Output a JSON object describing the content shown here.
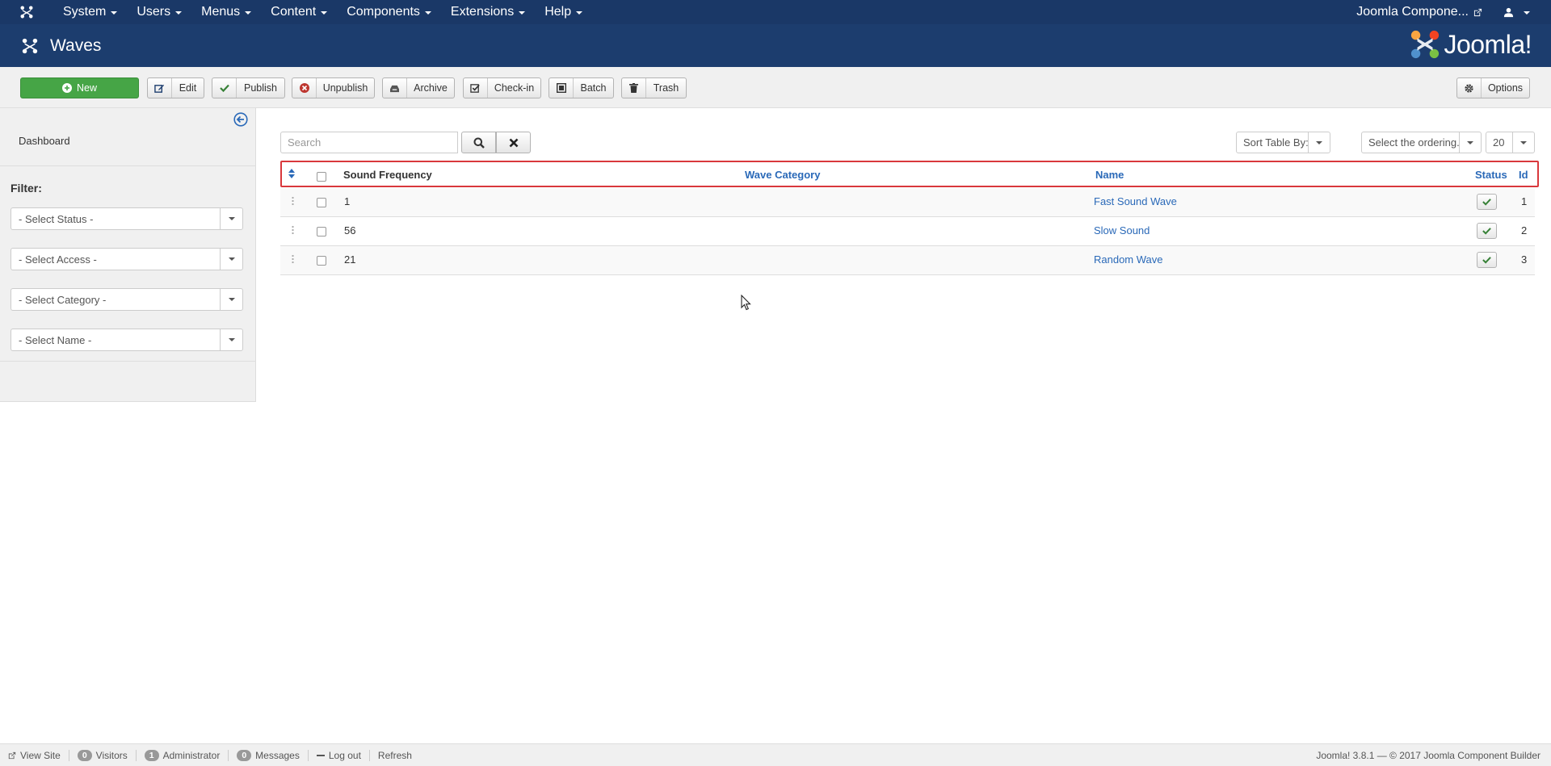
{
  "topnav": {
    "menus": [
      "System",
      "Users",
      "Menus",
      "Content",
      "Components",
      "Extensions",
      "Help"
    ],
    "site_link": "Joomla Compone..."
  },
  "header": {
    "title": "Waves",
    "brand": "Joomla!"
  },
  "toolbar": {
    "new": "New",
    "edit": "Edit",
    "publish": "Publish",
    "unpublish": "Unpublish",
    "archive": "Archive",
    "checkin": "Check-in",
    "batch": "Batch",
    "trash": "Trash",
    "options": "Options"
  },
  "sidebar": {
    "dashboard": "Dashboard",
    "filter_label": "Filter:",
    "selects": [
      "- Select Status -",
      "- Select Access -",
      "- Select Category -",
      "- Select Name -"
    ]
  },
  "search": {
    "placeholder": "Search"
  },
  "list_controls": {
    "sort_table_by": "Sort Table By:",
    "ordering": "Select the ordering.",
    "limit": "20"
  },
  "table": {
    "columns": {
      "sound_frequency": "Sound Frequency",
      "wave_category": "Wave Category",
      "name": "Name",
      "status": "Status",
      "id": "Id"
    },
    "rows": [
      {
        "sound_frequency": "1",
        "wave_category": "",
        "name": "Fast Sound Wave",
        "id": "1",
        "published": true
      },
      {
        "sound_frequency": "56",
        "wave_category": "",
        "name": "Slow Sound",
        "id": "2",
        "published": true
      },
      {
        "sound_frequency": "21",
        "wave_category": "",
        "name": "Random Wave",
        "id": "3",
        "published": true
      }
    ]
  },
  "footer": {
    "view_site": "View Site",
    "visitors_count": "0",
    "visitors_label": "Visitors",
    "admin_count": "1",
    "admin_label": "Administrator",
    "messages_count": "0",
    "messages_label": "Messages",
    "logout": "Log out",
    "refresh": "Refresh",
    "copyright": "Joomla! 3.8.1 — © 2017 Joomla Component Builder"
  },
  "colors": {
    "navbar": "#1a3867",
    "header": "#1c3d6e",
    "new_button": "#46a546",
    "link": "#2a69b8",
    "highlight_border": "#d9383c",
    "published_check": "#378137"
  }
}
